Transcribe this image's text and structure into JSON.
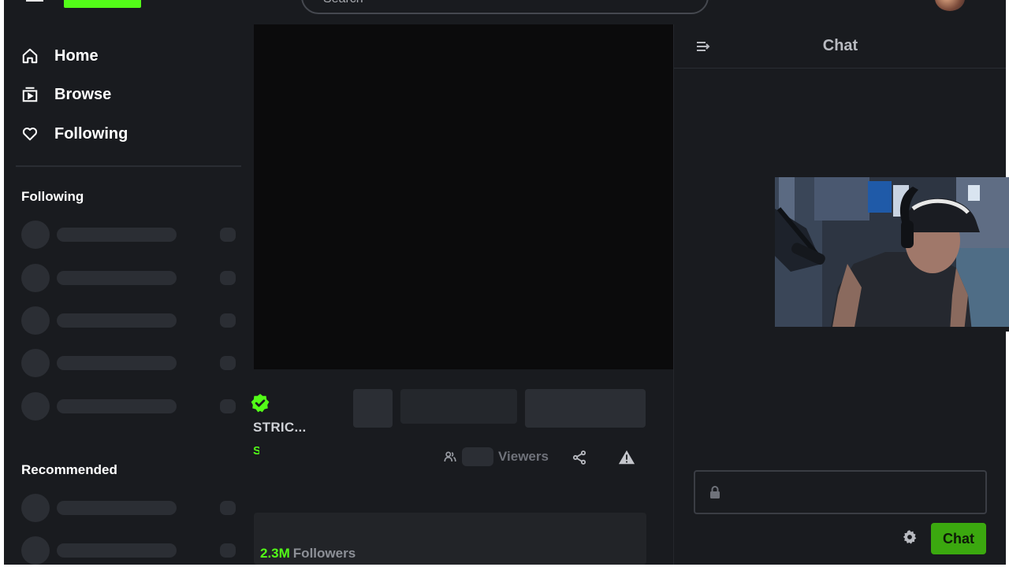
{
  "header": {
    "search_placeholder": "Search"
  },
  "sidebar": {
    "nav": [
      {
        "label": "Home",
        "icon": "home-icon"
      },
      {
        "label": "Browse",
        "icon": "browse-icon"
      },
      {
        "label": "Following",
        "icon": "heart-icon"
      }
    ],
    "following_title": "Following",
    "recommended_title": "Recommended"
  },
  "channel": {
    "name": "STRIC...",
    "category": "S",
    "followers_count": "2.3M",
    "followers_label": "Followers",
    "viewers_label": "Viewers"
  },
  "chat": {
    "title": "Chat",
    "send_label": "Chat"
  },
  "colors": {
    "accent": "#53fc18",
    "background": "#191b1f",
    "player": "#0b0b0c"
  }
}
